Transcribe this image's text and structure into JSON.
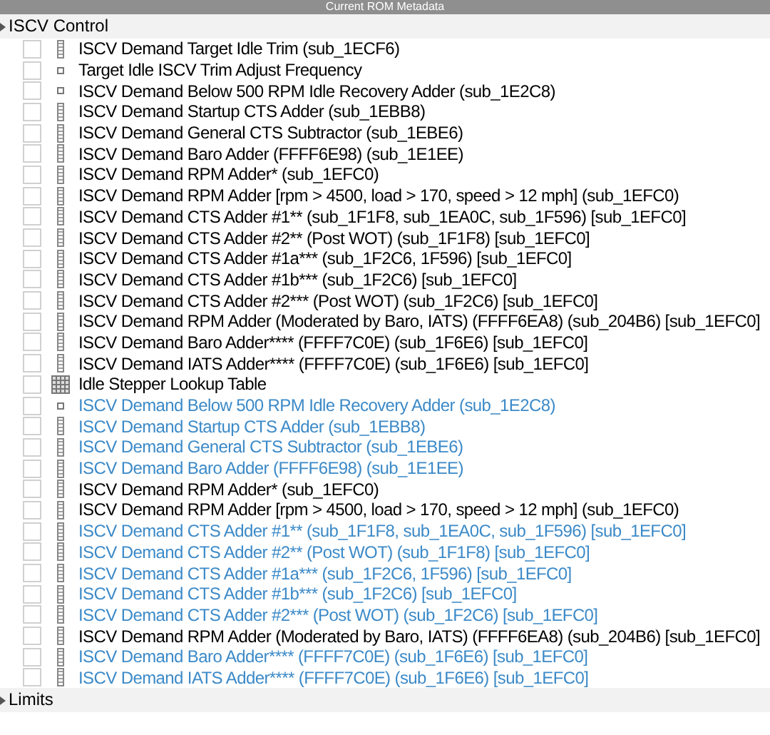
{
  "window": {
    "title": "Current ROM Metadata"
  },
  "groups": [
    {
      "label": "ISCV Control",
      "items": [
        {
          "kind": "series",
          "label": "ISCV Demand Target Idle Trim (sub_1ECF6)",
          "checked": false,
          "color": "#000000"
        },
        {
          "kind": "scalar",
          "label": "Target Idle ISCV Trim Adjust Frequency",
          "checked": false,
          "color": "#000000"
        },
        {
          "kind": "scalar",
          "label": "ISCV Demand Below 500 RPM Idle Recovery Adder (sub_1E2C8)",
          "checked": false,
          "color": "#000000"
        },
        {
          "kind": "series",
          "label": "ISCV Demand Startup CTS Adder (sub_1EBB8)",
          "checked": false,
          "color": "#000000"
        },
        {
          "kind": "series",
          "label": "ISCV Demand General CTS Subtractor (sub_1EBE6)",
          "checked": false,
          "color": "#000000"
        },
        {
          "kind": "series",
          "label": "ISCV Demand Baro Adder (FFFF6E98) (sub_1E1EE)",
          "checked": false,
          "color": "#000000"
        },
        {
          "kind": "series",
          "label": "ISCV Demand RPM Adder* (sub_1EFC0)",
          "checked": false,
          "color": "#000000"
        },
        {
          "kind": "series",
          "label": "ISCV Demand RPM Adder [rpm > 4500, load > 170, speed > 12 mph] (sub_1EFC0)",
          "checked": false,
          "color": "#000000"
        },
        {
          "kind": "series",
          "label": "ISCV Demand CTS Adder #1** (sub_1F1F8, sub_1EA0C, sub_1F596) [sub_1EFC0]",
          "checked": false,
          "color": "#000000"
        },
        {
          "kind": "series",
          "label": "ISCV Demand CTS Adder #2** (Post WOT) (sub_1F1F8) [sub_1EFC0]",
          "checked": false,
          "color": "#000000"
        },
        {
          "kind": "series",
          "label": "ISCV Demand CTS Adder #1a*** (sub_1F2C6, 1F596) [sub_1EFC0]",
          "checked": false,
          "color": "#000000"
        },
        {
          "kind": "series",
          "label": "ISCV Demand CTS Adder #1b*** (sub_1F2C6) [sub_1EFC0]",
          "checked": false,
          "color": "#000000"
        },
        {
          "kind": "series",
          "label": "ISCV Demand CTS Adder #2*** (Post WOT) (sub_1F2C6) [sub_1EFC0]",
          "checked": false,
          "color": "#000000"
        },
        {
          "kind": "series",
          "label": "ISCV Demand RPM Adder (Moderated by Baro, IATS) (FFFF6EA8) (sub_204B6) [sub_1EFC0]",
          "checked": false,
          "color": "#000000"
        },
        {
          "kind": "series",
          "label": "ISCV Demand Baro Adder**** (FFFF7C0E) (sub_1F6E6) [sub_1EFC0]",
          "checked": false,
          "color": "#000000"
        },
        {
          "kind": "series",
          "label": "ISCV Demand IATS Adder**** (FFFF7C0E) (sub_1F6E6) [sub_1EFC0]",
          "checked": false,
          "color": "#000000"
        },
        {
          "kind": "table",
          "label": "Idle Stepper Lookup Table",
          "checked": false,
          "color": "#000000"
        },
        {
          "kind": "scalar",
          "label": "ISCV Demand Below 500 RPM Idle Recovery Adder (sub_1E2C8)",
          "checked": false,
          "color": "#3c8ac8"
        },
        {
          "kind": "series",
          "label": "ISCV Demand Startup CTS Adder (sub_1EBB8)",
          "checked": false,
          "color": "#3c8ac8"
        },
        {
          "kind": "series",
          "label": "ISCV Demand General CTS Subtractor (sub_1EBE6)",
          "checked": false,
          "color": "#3c8ac8"
        },
        {
          "kind": "series",
          "label": "ISCV Demand Baro Adder (FFFF6E98) (sub_1E1EE)",
          "checked": false,
          "color": "#3c8ac8"
        },
        {
          "kind": "series",
          "label": "ISCV Demand RPM Adder* (sub_1EFC0)",
          "checked": false,
          "color": "#000000"
        },
        {
          "kind": "series",
          "label": "ISCV Demand RPM Adder [rpm > 4500, load > 170, speed > 12 mph] (sub_1EFC0)",
          "checked": false,
          "color": "#000000"
        },
        {
          "kind": "series",
          "label": "ISCV Demand CTS Adder #1** (sub_1F1F8, sub_1EA0C, sub_1F596) [sub_1EFC0]",
          "checked": false,
          "color": "#3c8ac8"
        },
        {
          "kind": "series",
          "label": "ISCV Demand CTS Adder #2** (Post WOT) (sub_1F1F8) [sub_1EFC0]",
          "checked": false,
          "color": "#3c8ac8"
        },
        {
          "kind": "series",
          "label": "ISCV Demand CTS Adder #1a*** (sub_1F2C6, 1F596) [sub_1EFC0]",
          "checked": false,
          "color": "#3c8ac8"
        },
        {
          "kind": "series",
          "label": "ISCV Demand CTS Adder #1b*** (sub_1F2C6) [sub_1EFC0]",
          "checked": false,
          "color": "#3c8ac8"
        },
        {
          "kind": "series",
          "label": "ISCV Demand CTS Adder #2*** (Post WOT) (sub_1F2C6) [sub_1EFC0]",
          "checked": false,
          "color": "#3c8ac8"
        },
        {
          "kind": "series",
          "label": "ISCV Demand RPM Adder (Moderated by Baro, IATS) (FFFF6EA8) (sub_204B6) [sub_1EFC0]",
          "checked": false,
          "color": "#000000"
        },
        {
          "kind": "series",
          "label": "ISCV Demand Baro Adder**** (FFFF7C0E) (sub_1F6E6) [sub_1EFC0]",
          "checked": false,
          "color": "#3c8ac8"
        },
        {
          "kind": "series",
          "label": "ISCV Demand IATS Adder**** (FFFF7C0E) (sub_1F6E6) [sub_1EFC0]",
          "checked": false,
          "color": "#3c8ac8"
        }
      ]
    },
    {
      "label": "Limits"
    }
  ]
}
